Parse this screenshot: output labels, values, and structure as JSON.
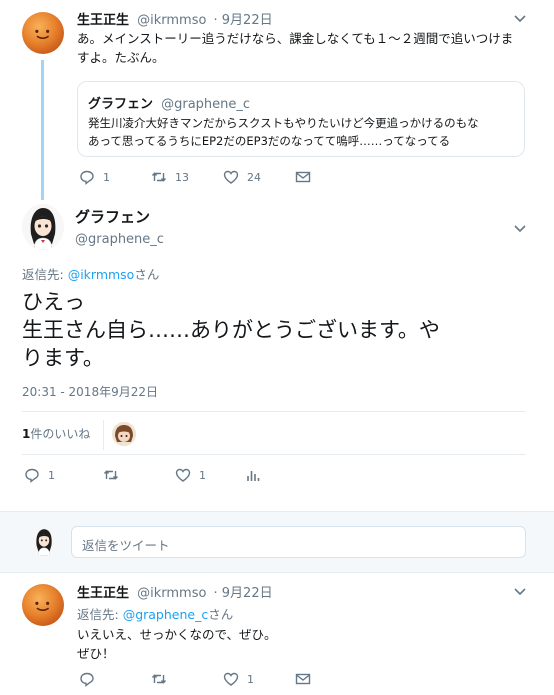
{
  "tweet1": {
    "name": "生王正生",
    "handle": "@ikrmmso",
    "date": "· 9月22日",
    "text_line1": "あ。メインストーリー追うだけなら、課金しなくても１～２週間で追いつけま",
    "text_line2": "すよ。たぶん。",
    "quote": {
      "name": "グラフェン",
      "handle": "@graphene_c",
      "line1": "発生川凌介大好きマンだからスクストもやりたいけど今更追っかけるのもな",
      "line2": "あって思ってるうちにEP2だのEP3だのなってて嗚呼……ってなってる"
    },
    "reply_count": "1",
    "retweet_count": "13",
    "like_count": "24"
  },
  "main": {
    "name": "グラフェン",
    "handle": "@graphene_c",
    "reply_to_label": "返信先: ",
    "reply_to_handle": "@ikrmmso",
    "reply_to_suffix": "さん",
    "text_line1": "ひえっ",
    "text_line2": "生王さん自ら……ありがとうございます。や",
    "text_line3": "ります。",
    "timestamp": "20:31 - 2018年9月22日",
    "likes_count": "1",
    "likes_label": "件のいいね",
    "reply_count": "1",
    "like_count": "1"
  },
  "compose": {
    "placeholder": "返信をツイート"
  },
  "tweet3": {
    "name": "生王正生",
    "handle": "@ikrmmso",
    "date": "· 9月22日",
    "reply_to_label": "返信先: ",
    "reply_to_handle": "@graphene_c",
    "reply_to_suffix": "さん",
    "text_line1": "いえいえ、せっかくなので、ぜひ。",
    "text_line2": "ぜひ！",
    "reply_count": "",
    "like_count": "1"
  },
  "colors": {
    "accent": "#1da1f2",
    "thread_line": "#a3d3f5",
    "muted": "#657786",
    "border": "#e6ecf0"
  }
}
